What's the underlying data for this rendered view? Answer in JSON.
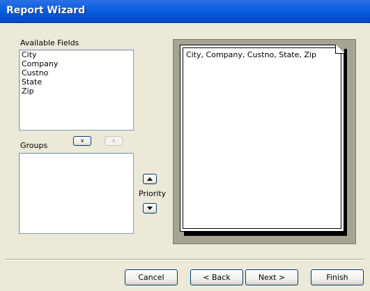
{
  "window": {
    "title": "Report Wizard"
  },
  "available_fields": {
    "label": "Available Fields",
    "items": [
      "City",
      "Company",
      "Custno",
      "State",
      "Zip"
    ]
  },
  "groups": {
    "label": "Groups",
    "items": [],
    "move_down_icon": "chevron-down-icon",
    "move_up_icon": "chevron-up-icon"
  },
  "priority": {
    "label": "Priority",
    "up_icon": "arrow-up-icon",
    "down_icon": "arrow-down-icon"
  },
  "preview": {
    "text": "City, Company, Custno, State, Zip"
  },
  "buttons": {
    "cancel": "Cancel",
    "back": "< Back",
    "next": "Next >",
    "finish": "Finish"
  },
  "colors": {
    "titlebar": "#0A5EE0",
    "dialog_bg": "#ECE9D8",
    "button_border": "#003C74"
  }
}
